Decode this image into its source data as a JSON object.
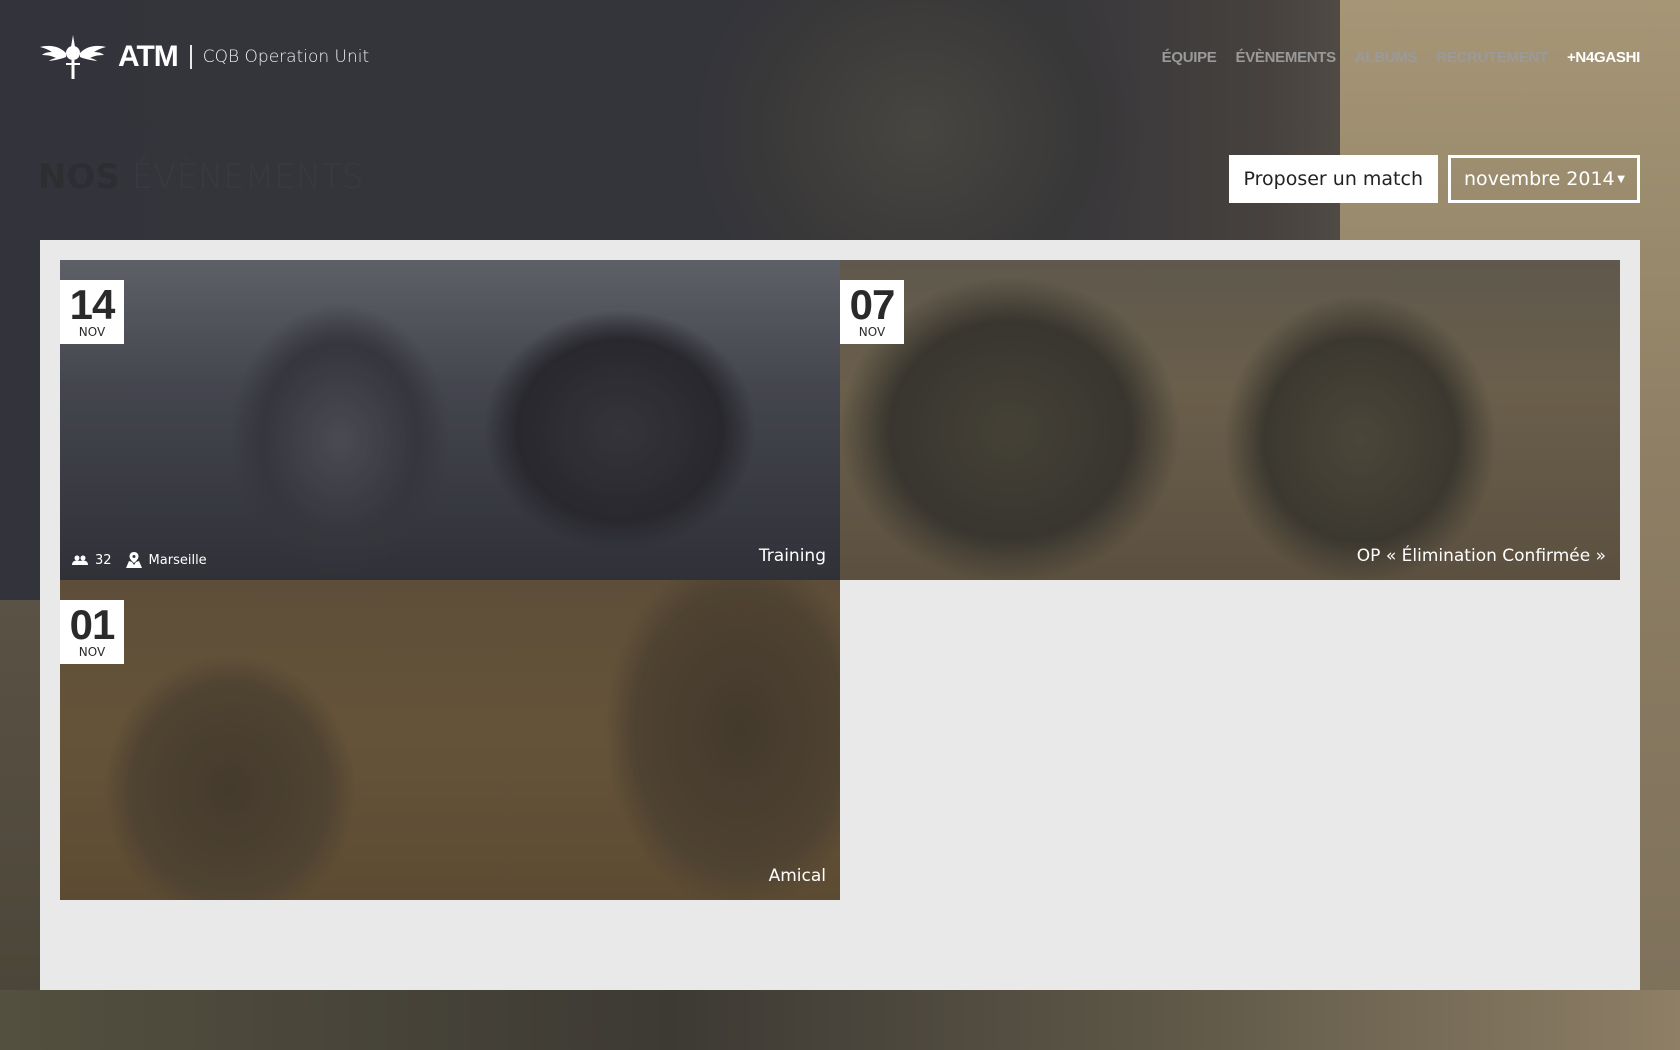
{
  "brand": {
    "logo_icon": "winged-dagger-emblem",
    "name": "ATM",
    "subtitle": "CQB Operation Unit"
  },
  "nav": {
    "items": [
      {
        "label": "Équipe"
      },
      {
        "label": "Évènements"
      },
      {
        "label": "Albums"
      },
      {
        "label": "Recrutement"
      }
    ],
    "user_label": "+N4gashi"
  },
  "page": {
    "title_bold": "NOS",
    "title_light": "ÉVÈNEMENTS"
  },
  "controls": {
    "propose_label": "Proposer un match",
    "month_value": "novembre 2014",
    "caret_icon": "triangle-down"
  },
  "events": [
    {
      "day": "14",
      "month": "NOV",
      "title": "Training",
      "participants": "32",
      "location": "Marseille",
      "participants_icon": "users-icon",
      "location_icon": "map-icon"
    },
    {
      "day": "07",
      "month": "NOV",
      "title": "OP « Élimination Confirmée »"
    },
    {
      "day": "01",
      "month": "NOV",
      "title": "Amical"
    }
  ],
  "colors": {
    "panel_bg": "#e9e9e9",
    "nav_inactive": "#9a9a9a",
    "nav_active": "#ffffff"
  }
}
